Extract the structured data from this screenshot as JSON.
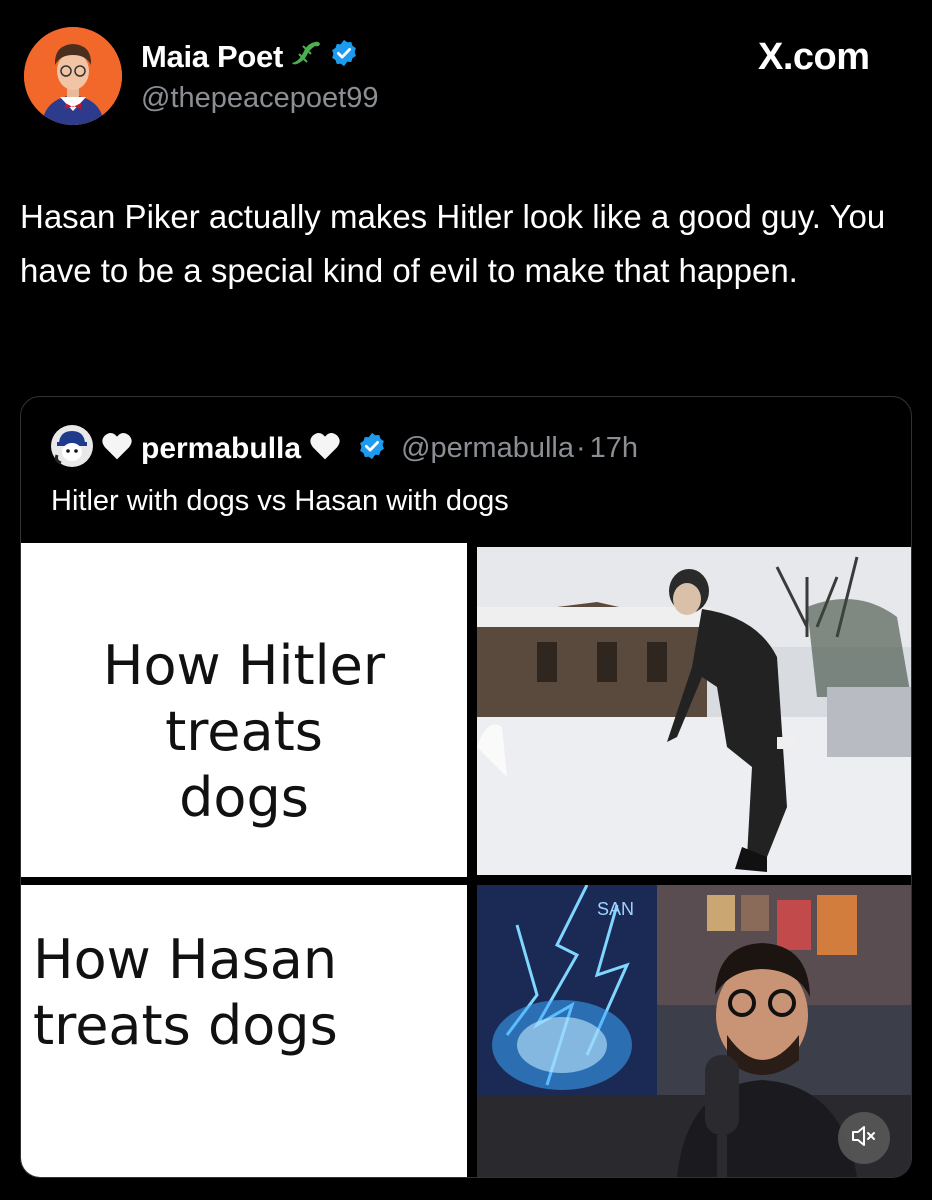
{
  "author": {
    "display_name": "Maia Poet",
    "handle": "@thepeacepoet99",
    "name_emoji_icon": "lizard-icon",
    "verified_icon": "verified-badge-icon"
  },
  "brand": {
    "label": "X.com"
  },
  "tweet": {
    "text": "Hasan Piker actually makes Hitler look like a good guy. You have to be a special kind of evil to make that happen."
  },
  "quoted": {
    "display_name": "permabulla",
    "handle": "@permabulla",
    "separator": "·",
    "time": "17h",
    "text": "Hitler with dogs vs Hasan with dogs",
    "meme": {
      "top_caption": [
        "How Hitler",
        "treats",
        "dogs"
      ],
      "bottom_caption": [
        "How Hasan",
        "treats dogs"
      ],
      "stream_sign": "SAN"
    }
  },
  "controls": {
    "mute_icon": "speaker-muted-icon"
  },
  "colors": {
    "verified": "#1d9bf0",
    "avatar_bg": "#f2682b",
    "handle": "#8b8f93"
  }
}
